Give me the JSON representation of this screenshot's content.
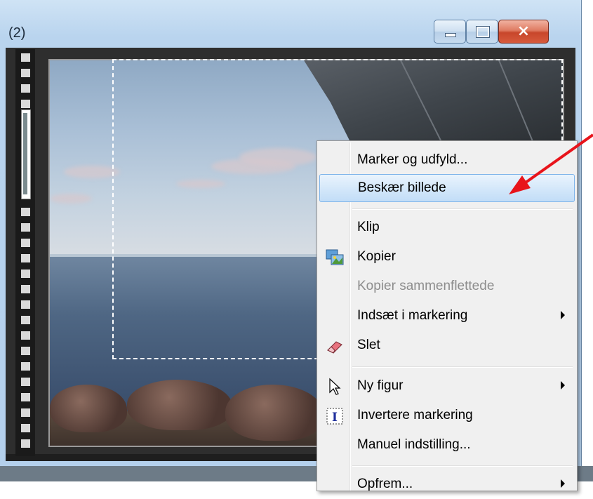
{
  "window": {
    "title_fragment": "(2)",
    "minimize_label": "",
    "maximize_label": "",
    "close_label": "×"
  },
  "context_menu": {
    "items": [
      {
        "label": "Marker og udfyld...",
        "enabled": true,
        "highlighted": false,
        "submenu": false,
        "icon": ""
      },
      {
        "label": "Beskær billede",
        "enabled": true,
        "highlighted": true,
        "submenu": false,
        "icon": ""
      },
      {
        "label": "Klip",
        "enabled": true,
        "highlighted": false,
        "submenu": false,
        "icon": ""
      },
      {
        "label": "Kopier",
        "enabled": true,
        "highlighted": false,
        "submenu": false,
        "icon": "copy-image-icon"
      },
      {
        "label": "Kopier sammenflettede",
        "enabled": false,
        "highlighted": false,
        "submenu": false,
        "icon": ""
      },
      {
        "label": "Indsæt i markering",
        "enabled": true,
        "highlighted": false,
        "submenu": true,
        "icon": ""
      },
      {
        "label": "Slet",
        "enabled": true,
        "highlighted": false,
        "submenu": false,
        "icon": "eraser-icon"
      },
      {
        "label": "Ny figur",
        "enabled": true,
        "highlighted": false,
        "submenu": true,
        "icon": "cursor-arrow-icon"
      },
      {
        "label": "Invertere markering",
        "enabled": true,
        "highlighted": false,
        "submenu": false,
        "icon": "invert-selection-icon"
      },
      {
        "label": "Manuel indstilling...",
        "enabled": true,
        "highlighted": false,
        "submenu": false,
        "icon": ""
      },
      {
        "label": "Opfrem...",
        "enabled": true,
        "highlighted": false,
        "submenu": true,
        "icon": ""
      }
    ]
  },
  "colors": {
    "menu_highlight_border": "#7eb4ea",
    "annotation_arrow": "#e8141b",
    "disabled_text": "#8d8d8d"
  }
}
